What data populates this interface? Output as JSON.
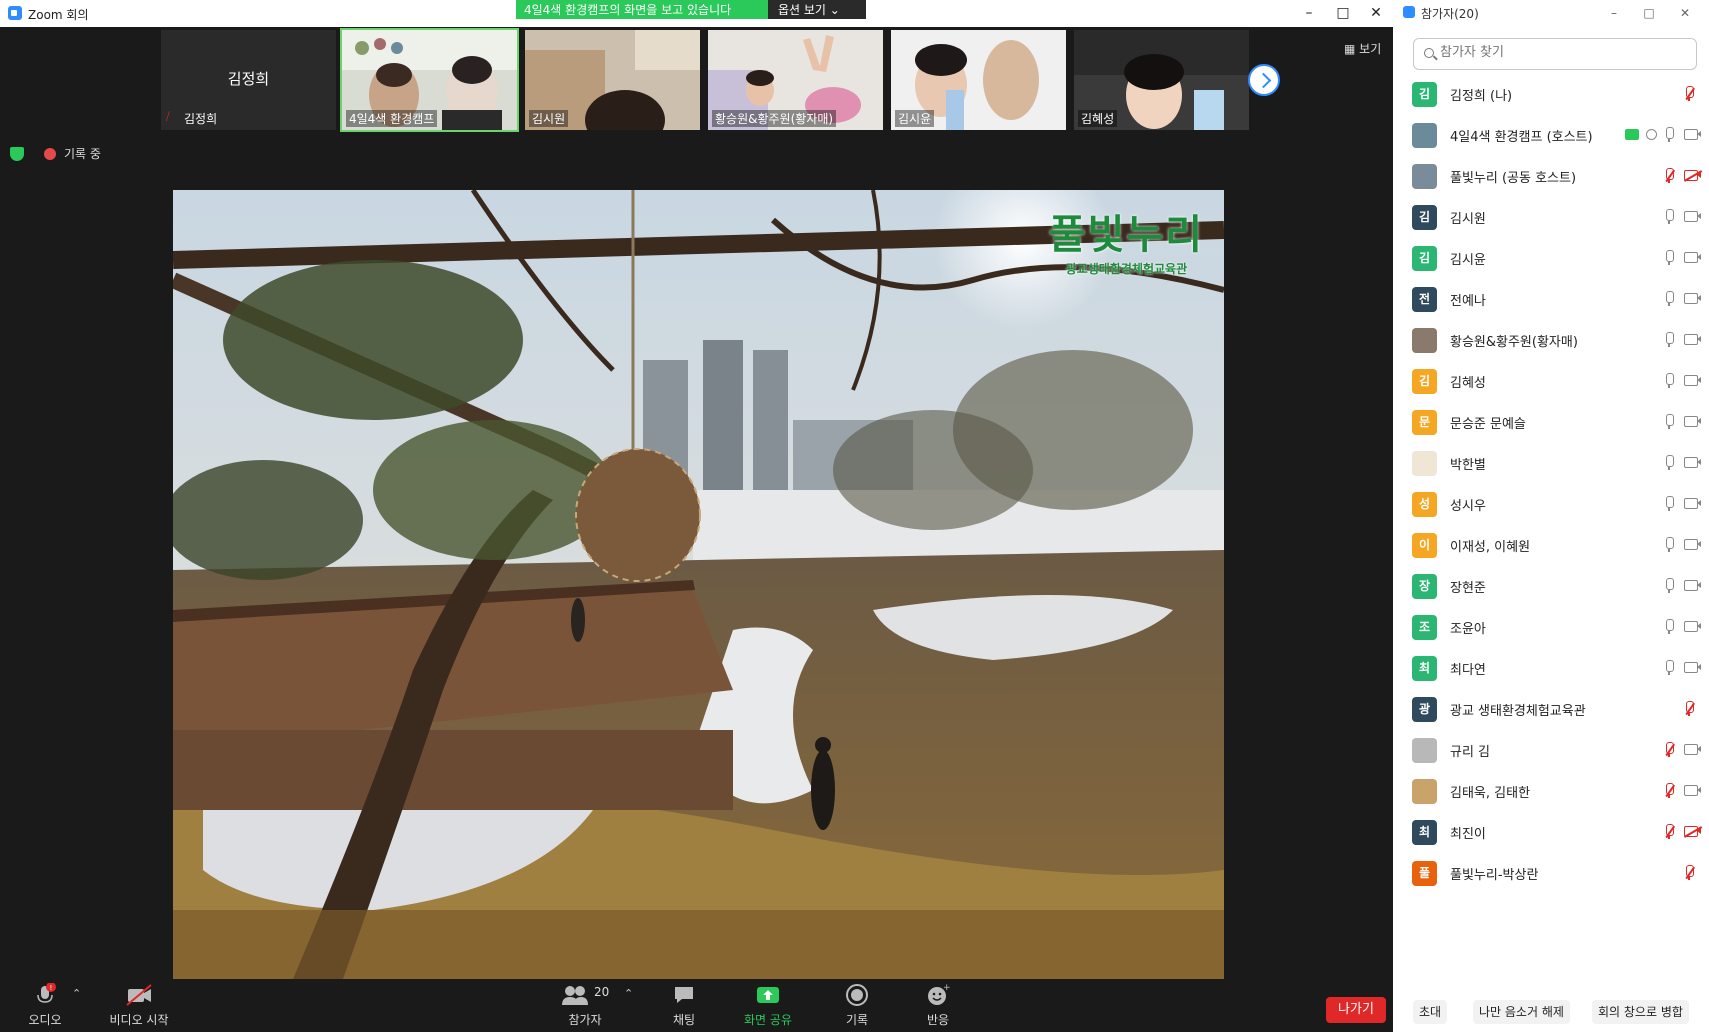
{
  "window": {
    "title": "Zoom 회의"
  },
  "share_banner": {
    "text": "4일4색 환경캠프의 화면을 보고 있습니다",
    "view_options": "옵션 보기 ⌄"
  },
  "view_button": "보기",
  "self_tile": {
    "name": "김정희",
    "caption": "김정희"
  },
  "thumbnails": [
    "4일4색 환경캠프",
    "김시원",
    "황승원&황주원(황자매)",
    "김시윤",
    "김혜성"
  ],
  "status": {
    "recording": "기록 중"
  },
  "shared_screen": {
    "brand_title": "풀빛누리",
    "brand_subtitle": "광교생태환경체험교육관"
  },
  "toolbar": {
    "audio": "오디오",
    "video": "비디오 시작",
    "participants": "참가자",
    "participants_count": "20",
    "chat": "채팅",
    "share": "화면 공유",
    "record": "기록",
    "reactions": "반응",
    "leave": "나가기"
  },
  "panel": {
    "title": "참가자(20)",
    "search_placeholder": "참가자 찾기",
    "footer": {
      "invite": "초대",
      "unmute_me": "나만 음소거 해제",
      "merge": "회의 창으로 병합"
    },
    "participants": [
      {
        "name": "김정희 (나)",
        "initial": "김",
        "color": "#2BB673",
        "mic": "muted",
        "cam": "none"
      },
      {
        "name": "4일4색 환경캠프 (호스트)",
        "initial": "",
        "color": "#6b8a9a",
        "mic": "on",
        "cam": "on",
        "sharing": true
      },
      {
        "name": "풀빛누리 (공동 호스트)",
        "initial": "",
        "color": "#7a8c99",
        "mic": "muted",
        "cam": "off"
      },
      {
        "name": "김시원",
        "initial": "김",
        "color": "#2f4a5c",
        "mic": "on",
        "cam": "on"
      },
      {
        "name": "김시윤",
        "initial": "김",
        "color": "#2BB673",
        "mic": "on",
        "cam": "on"
      },
      {
        "name": "전예나",
        "initial": "전",
        "color": "#2f4a5c",
        "mic": "on",
        "cam": "on"
      },
      {
        "name": "황승원&황주원(황자매)",
        "initial": "",
        "color": "#8a7a6c",
        "mic": "on",
        "cam": "on"
      },
      {
        "name": "김혜성",
        "initial": "김",
        "color": "#F5A623",
        "mic": "on",
        "cam": "on"
      },
      {
        "name": "문승준 문예슬",
        "initial": "문",
        "color": "#F5A623",
        "mic": "on",
        "cam": "on"
      },
      {
        "name": "박한별",
        "initial": "",
        "color": "#f0e6d6",
        "mic": "on",
        "cam": "on"
      },
      {
        "name": "성시우",
        "initial": "성",
        "color": "#F5A623",
        "mic": "on",
        "cam": "on"
      },
      {
        "name": "이재성, 이혜원",
        "initial": "이",
        "color": "#F5A623",
        "mic": "on",
        "cam": "on"
      },
      {
        "name": "장현준",
        "initial": "장",
        "color": "#2BB673",
        "mic": "on",
        "cam": "on"
      },
      {
        "name": "조윤아",
        "initial": "조",
        "color": "#2BB673",
        "mic": "on",
        "cam": "on"
      },
      {
        "name": "최다연",
        "initial": "최",
        "color": "#2BB673",
        "mic": "on",
        "cam": "on"
      },
      {
        "name": "광교 생태환경체험교육관",
        "initial": "광",
        "color": "#2f4a5c",
        "mic": "muted",
        "cam": "none"
      },
      {
        "name": "규리 김",
        "initial": "",
        "color": "#b8b8b8",
        "mic": "muted",
        "cam": "on"
      },
      {
        "name": "김태욱, 김태한",
        "initial": "",
        "color": "#c9a36a",
        "mic": "muted",
        "cam": "on"
      },
      {
        "name": "최진이",
        "initial": "최",
        "color": "#2f4a5c",
        "mic": "muted",
        "cam": "off"
      },
      {
        "name": "풀빛누리-박상란",
        "initial": "풀",
        "color": "#E8620E",
        "mic": "muted",
        "cam": "none"
      }
    ]
  }
}
